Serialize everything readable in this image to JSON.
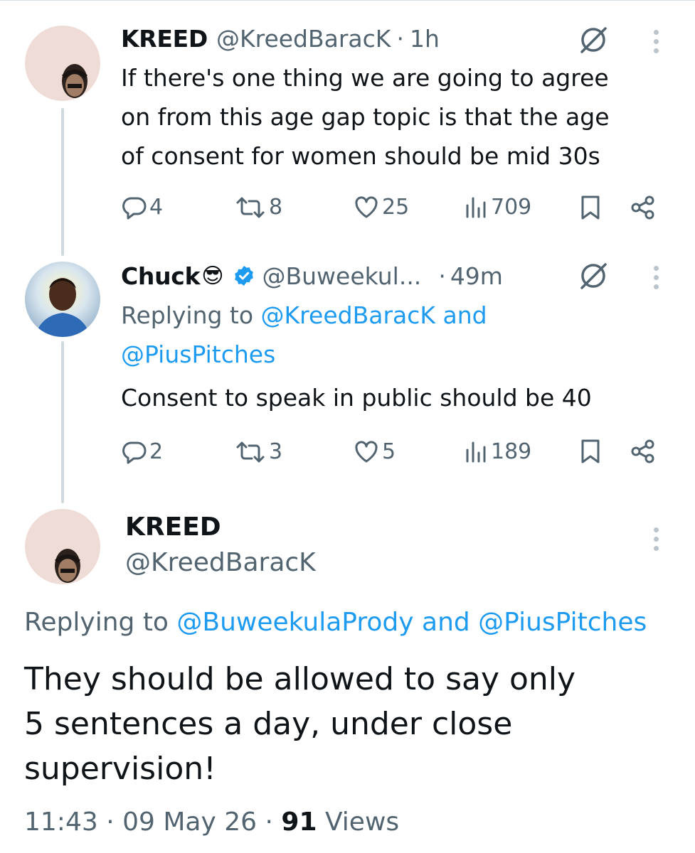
{
  "tweet1": {
    "name": "KREED",
    "handle": "@KreedBaracK",
    "separator": "·",
    "time": "1h",
    "text_lines": [
      "If there's one thing we are going to agree",
      "on from this age gap topic is that the age",
      "of consent for women should be mid 30s"
    ],
    "stats": {
      "replies": "4",
      "reposts": "8",
      "likes": "25",
      "views": "709"
    }
  },
  "tweet2": {
    "name": "Chuck",
    "emoji": "😎",
    "handle": "@Buweekul...",
    "separator": "·",
    "time": "49m",
    "replying_prefix": "Replying to",
    "replying_line1_link": "@KreedBaracK and",
    "replying_line2_link": "@PiusPitches",
    "text": "Consent to speak in public should be 40",
    "stats": {
      "replies": "2",
      "reposts": "3",
      "likes": "5",
      "views": "189"
    }
  },
  "tweet3": {
    "name": "KREED",
    "handle": "@KreedBaracK",
    "replying_prefix": "Replying to",
    "replying_link": "@BuweekulaPrody and @PiusPitches",
    "text_lines": [
      "They should be allowed to say only",
      "5 sentences a day, under close",
      "supervision!"
    ],
    "time": "11:43",
    "separator": "·",
    "date": "09 May 26",
    "views_count": "91",
    "views_label": "Views"
  },
  "icons": {
    "reply": "reply-bubble-icon",
    "repost": "repost-arrows-icon",
    "like": "heart-icon",
    "views": "views-bar-chart-icon",
    "bookmark": "bookmark-icon",
    "share": "share-icon",
    "grok": "grok-slash-circle-icon",
    "more": "more-vertical-icon",
    "verified": "verified-badge-icon"
  },
  "colors": {
    "link": "#1d9bf0",
    "muted": "#536471",
    "text": "#0f1419",
    "verified": "#1d9bf0"
  }
}
